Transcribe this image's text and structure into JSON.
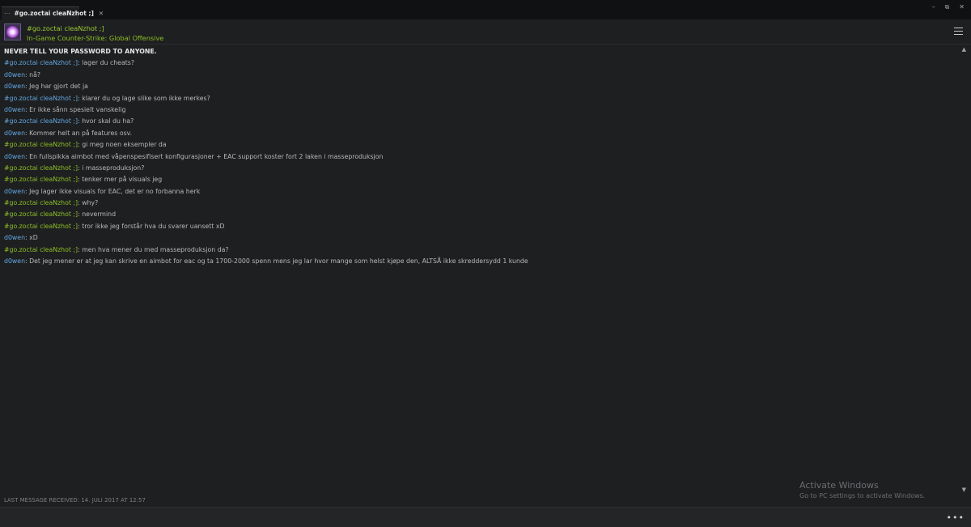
{
  "tab": {
    "dots": "⋯",
    "title": "#go.zoctai cleaNzhot ;]",
    "close": "✕"
  },
  "window_controls": {
    "minimize": "–",
    "maximize": "⧉",
    "close": "✕"
  },
  "header": {
    "name": "#go.zoctai cleaNzhot ;]",
    "status": "In-Game Counter-Strike: Global Offensive",
    "avatar_icon": "avatar-image",
    "menu_icon": "hamburger-menu-icon"
  },
  "notice": "NEVER TELL YOUR PASSWORD TO ANYONE.",
  "messages": [
    {
      "sender": "#go.zoctai cleaNzhot ;]",
      "text": ": lager du cheats?",
      "color": "blue"
    },
    {
      "sender": "d0wen",
      "text": ": nå?",
      "color": "blue"
    },
    {
      "sender": "d0wen",
      "text": ": Jeg har gjort det ja",
      "color": "blue"
    },
    {
      "sender": "#go.zoctai cleaNzhot ;]",
      "text": ": klarer du og lage slike som ikke merkes?",
      "color": "blue"
    },
    {
      "sender": "d0wen",
      "text": ": Er ikke sånn spesielt vanskelig",
      "color": "blue"
    },
    {
      "sender": "#go.zoctai cleaNzhot ;]",
      "text": ": hvor skal du ha?",
      "color": "blue"
    },
    {
      "sender": "d0wen",
      "text": ": Kommer helt an på features osv.",
      "color": "blue"
    },
    {
      "sender": "#go.zoctai cleaNzhot ;]",
      "text": ": gi meg noen eksempler da",
      "color": "green"
    },
    {
      "sender": "d0wen",
      "text": ": En fullspikka aimbot med våpenspesifisert konfigurasjoner + EAC support koster fort 2 laken i masseproduksjon",
      "color": "blue"
    },
    {
      "sender": "#go.zoctai cleaNzhot ;]",
      "text": ": i masseproduksjon?",
      "color": "green"
    },
    {
      "sender": "#go.zoctai cleaNzhot ;]",
      "text": ": tenker mer på visuals jeg",
      "color": "green"
    },
    {
      "sender": "d0wen",
      "text": ": Jeg lager ikke visuals for EAC, det er no forbanna herk",
      "color": "blue"
    },
    {
      "sender": "#go.zoctai cleaNzhot ;]",
      "text": ": why?",
      "color": "green"
    },
    {
      "sender": "#go.zoctai cleaNzhot ;]",
      "text": ": nevermind",
      "color": "green"
    },
    {
      "sender": "#go.zoctai cleaNzhot ;]",
      "text": ": tror ikke jeg forstår hva du svarer uansett xD",
      "color": "green"
    },
    {
      "sender": "d0wen",
      "text": ": xD",
      "color": "blue"
    },
    {
      "sender": "#go.zoctai cleaNzhot ;]",
      "text": ": men hva mener du med masseproduksjon da?",
      "color": "green"
    },
    {
      "sender": "d0wen",
      "text": ": Det jeg mener er at jeg kan skrive en aimbot for eac og ta 1700-2000 spenn mens jeg lar hvor mange som helst kjøpe den, ALTSÅ ikke skreddersydd 1 kunde",
      "color": "blue"
    }
  ],
  "scrollbar": {
    "up": "▲",
    "down": "▼"
  },
  "watermark": {
    "title": "Activate Windows",
    "subtitle": "Go to PC settings to activate Windows."
  },
  "footer": {
    "last_message": "LAST MESSAGE RECEIVED: 14. JULI 2017 AT 12:57",
    "input_value": "",
    "more": "•••"
  },
  "colors": {
    "blue_name": "#62a7e3",
    "green_name": "#8cbf26",
    "background": "#1e1f20"
  }
}
